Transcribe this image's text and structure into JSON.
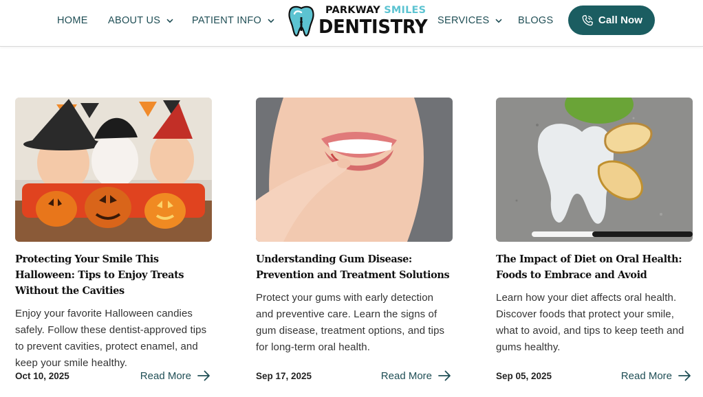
{
  "nav": {
    "home": "HOME",
    "about": "ABOUT US",
    "patient_info": "PATIENT INFO",
    "services": "SERVICES",
    "blogs": "BLOGS",
    "call_button": "Call Now"
  },
  "logo": {
    "word1": "PARKWAY",
    "word2": "SMILES",
    "line2": "DENTISTRY"
  },
  "colors": {
    "brand_teal": "#1b5d61",
    "logo_accent": "#5cc3d1",
    "nav_text": "#1f4e55"
  },
  "posts": [
    {
      "image": "halloween-kids-pumpkins",
      "title": "Protecting Your Smile This Halloween: Tips to Enjoy Treats Without the Cavities",
      "excerpt": "Enjoy your favorite Halloween candies safely. Follow these dentist-approved tips to prevent cavities, protect enamel, and keep your smile healthy.",
      "date": "Oct 10, 2025",
      "read_more": "Read More"
    },
    {
      "image": "gum-disease-lip-finger",
      "title": "Understanding Gum Disease: Prevention and Treatment Solutions",
      "excerpt": "Protect your gums with early detection and preventive care. Learn the signs of gum disease, treatment options, and tips for long-term oral health.",
      "date": "Sep 17, 2025",
      "read_more": "Read More"
    },
    {
      "image": "paper-tooth-apple-slices",
      "title": "The Impact of Diet on Oral Health: Foods to Embrace and Avoid",
      "excerpt": "Learn how your diet affects oral health. Discover foods that protect your smile, what to avoid, and tips to keep teeth and gums healthy.",
      "date": "Sep 05, 2025",
      "read_more": "Read More"
    }
  ]
}
